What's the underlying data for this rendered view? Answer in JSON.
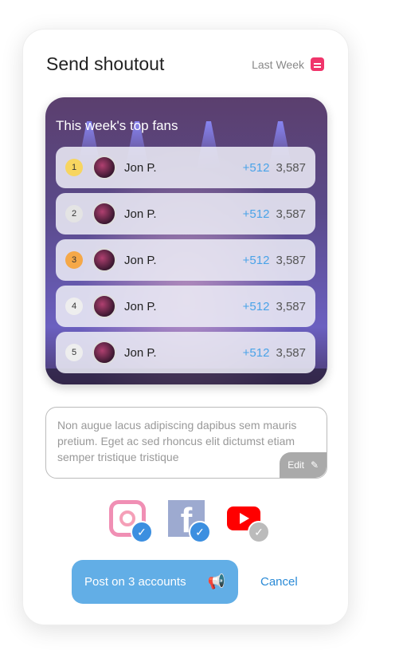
{
  "header": {
    "title": "Send shoutout",
    "period": "Last Week"
  },
  "banner": {
    "title": "This week's top fans",
    "fans": [
      {
        "rank": "1",
        "name": "Jon P.",
        "delta": "+512",
        "total": "3,587"
      },
      {
        "rank": "2",
        "name": "Jon P.",
        "delta": "+512",
        "total": "3,587"
      },
      {
        "rank": "3",
        "name": "Jon P.",
        "delta": "+512",
        "total": "3,587"
      },
      {
        "rank": "4",
        "name": "Jon P.",
        "delta": "+512",
        "total": "3,587"
      },
      {
        "rank": "5",
        "name": "Jon P.",
        "delta": "+512",
        "total": "3,587"
      }
    ]
  },
  "message": {
    "text": "Non augue lacus adipiscing dapibus sem mauris pretium. Eget ac sed rhoncus elit dictumst etiam semper tristique tristique",
    "edit_label": "Edit"
  },
  "accounts": [
    {
      "name": "instagram",
      "checked": true
    },
    {
      "name": "facebook",
      "checked": true
    },
    {
      "name": "youtube",
      "checked": false
    }
  ],
  "actions": {
    "post_label": "Post on 3 accounts",
    "cancel_label": "Cancel"
  },
  "colors": {
    "accent": "#62aee6",
    "link": "#2a8ad6",
    "calendar": "#f0356b"
  }
}
